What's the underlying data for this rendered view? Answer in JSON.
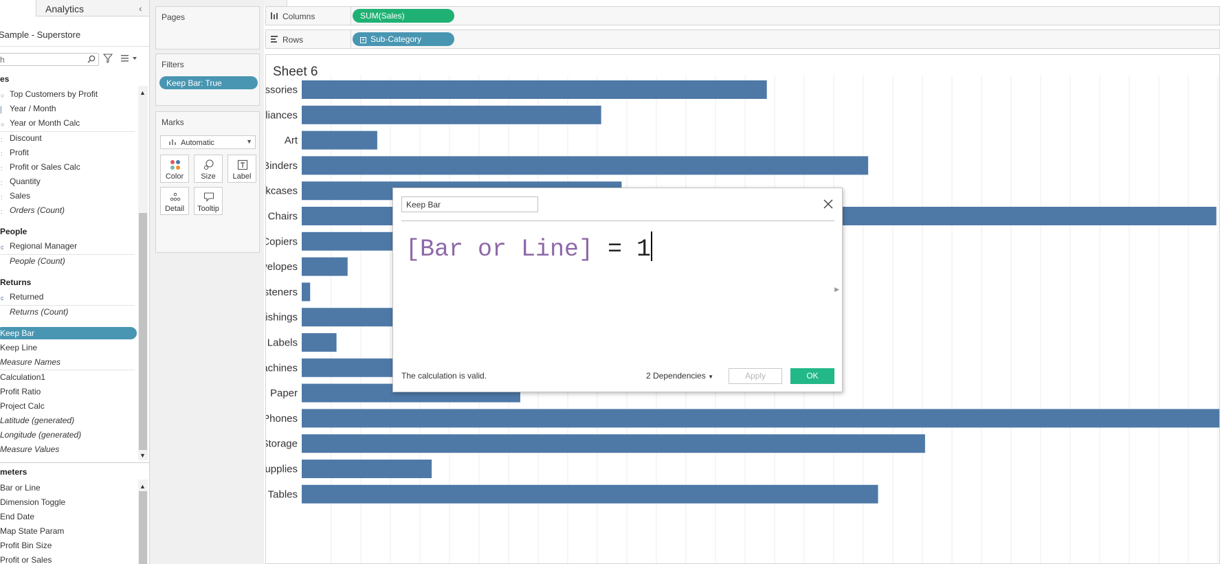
{
  "data_pane": {
    "tab_analytics": "Analytics",
    "source_name": "Sample - Superstore",
    "search_text": "h",
    "section_partial": "es",
    "items": [
      {
        "label": "Top Customers by Profit",
        "italic": false
      },
      {
        "label": "Year / Month",
        "italic": false
      },
      {
        "label": "Year or Month Calc",
        "italic": false
      },
      {
        "label": "Discount",
        "italic": false
      },
      {
        "label": "Profit",
        "italic": false
      },
      {
        "label": "Profit or Sales Calc",
        "italic": false
      },
      {
        "label": "Quantity",
        "italic": false
      },
      {
        "label": "Sales",
        "italic": false
      },
      {
        "label": "Orders (Count)",
        "italic": true
      }
    ],
    "people_section": "People",
    "people_items": [
      {
        "label": "Regional Manager",
        "italic": false
      },
      {
        "label": "People (Count)",
        "italic": true
      }
    ],
    "returns_section": "Returns",
    "returns_items": [
      {
        "label": "Returned",
        "italic": false
      },
      {
        "label": "Returns (Count)",
        "italic": true
      }
    ],
    "selected_item": "Keep Bar",
    "more_items": [
      {
        "label": "Keep Line",
        "italic": false
      },
      {
        "label": "Measure Names",
        "italic": true
      },
      {
        "label": "Calculation1",
        "italic": false
      },
      {
        "label": "Profit Ratio",
        "italic": false
      },
      {
        "label": "Project Calc",
        "italic": false
      },
      {
        "label": "Latitude (generated)",
        "italic": true
      },
      {
        "label": "Longitude (generated)",
        "italic": true
      },
      {
        "label": "Measure Values",
        "italic": true
      }
    ],
    "parameters_section": "meters",
    "parameters": [
      "Bar or Line",
      "Dimension Toggle",
      "End Date",
      "Map State Param",
      "Profit Bin Size",
      "Profit or Sales"
    ]
  },
  "pages": {
    "title": "Pages"
  },
  "filters": {
    "title": "Filters",
    "pill": "Keep Bar: True"
  },
  "marks": {
    "title": "Marks",
    "type": "Automatic",
    "buttons": [
      "Color",
      "Size",
      "Label",
      "Detail",
      "Tooltip"
    ]
  },
  "columns_shelf": {
    "label": "Columns",
    "pill": "SUM(Sales)"
  },
  "rows_shelf": {
    "label": "Rows",
    "pill": "Sub-Category"
  },
  "sheet": {
    "title": "Sheet 6"
  },
  "chart_data": {
    "type": "bar",
    "orientation": "horizontal",
    "categories": [
      "Accessories",
      "Appliances",
      "Art",
      "Binders",
      "Bookcases",
      "Chairs",
      "Copiers",
      "Envelopes",
      "Fasteners",
      "Furnishings",
      "Labels",
      "Machines",
      "Paper",
      "Phones",
      "Storage",
      "Supplies",
      "Tables"
    ],
    "values": [
      167026,
      107532,
      27119,
      203413,
      114880,
      328450,
      149528,
      16476,
      3024,
      91705,
      12486,
      189239,
      78479,
      330007,
      223844,
      46674,
      206966
    ],
    "xlim": [
      0,
      330007
    ],
    "bar_color": "#4e79a7",
    "grid": true
  },
  "calc_dialog": {
    "name": "Keep Bar",
    "formula_field": "[Bar or Line]",
    "formula_rest": " = 1",
    "status": "The calculation is valid.",
    "dependencies": "2 Dependencies",
    "apply_label": "Apply",
    "ok_label": "OK"
  },
  "colors": {
    "pill_blue": "#4996b2",
    "pill_green": "#1fb174",
    "ok_green": "#22b888",
    "bar": "#4e79a7"
  }
}
